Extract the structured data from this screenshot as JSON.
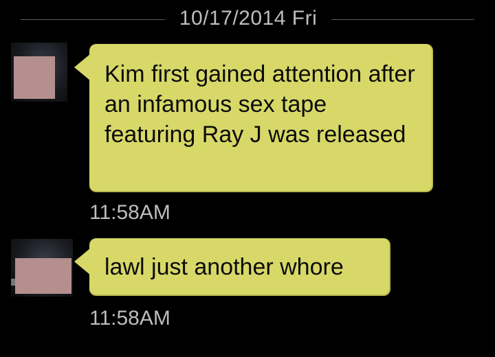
{
  "conversation": {
    "date_divider": "10/17/2014 Fri",
    "messages": [
      {
        "text": "Kim first gained attention after an infamous sex tape featuring Ray J was released",
        "time": "11:58AM"
      },
      {
        "text": "lawl just another whore",
        "time": "11:58AM"
      }
    ]
  },
  "colors": {
    "background": "#000000",
    "bubble": "#d7d868",
    "meta_text": "#bdbdbd",
    "avatar_blur": "#b48f8e"
  }
}
